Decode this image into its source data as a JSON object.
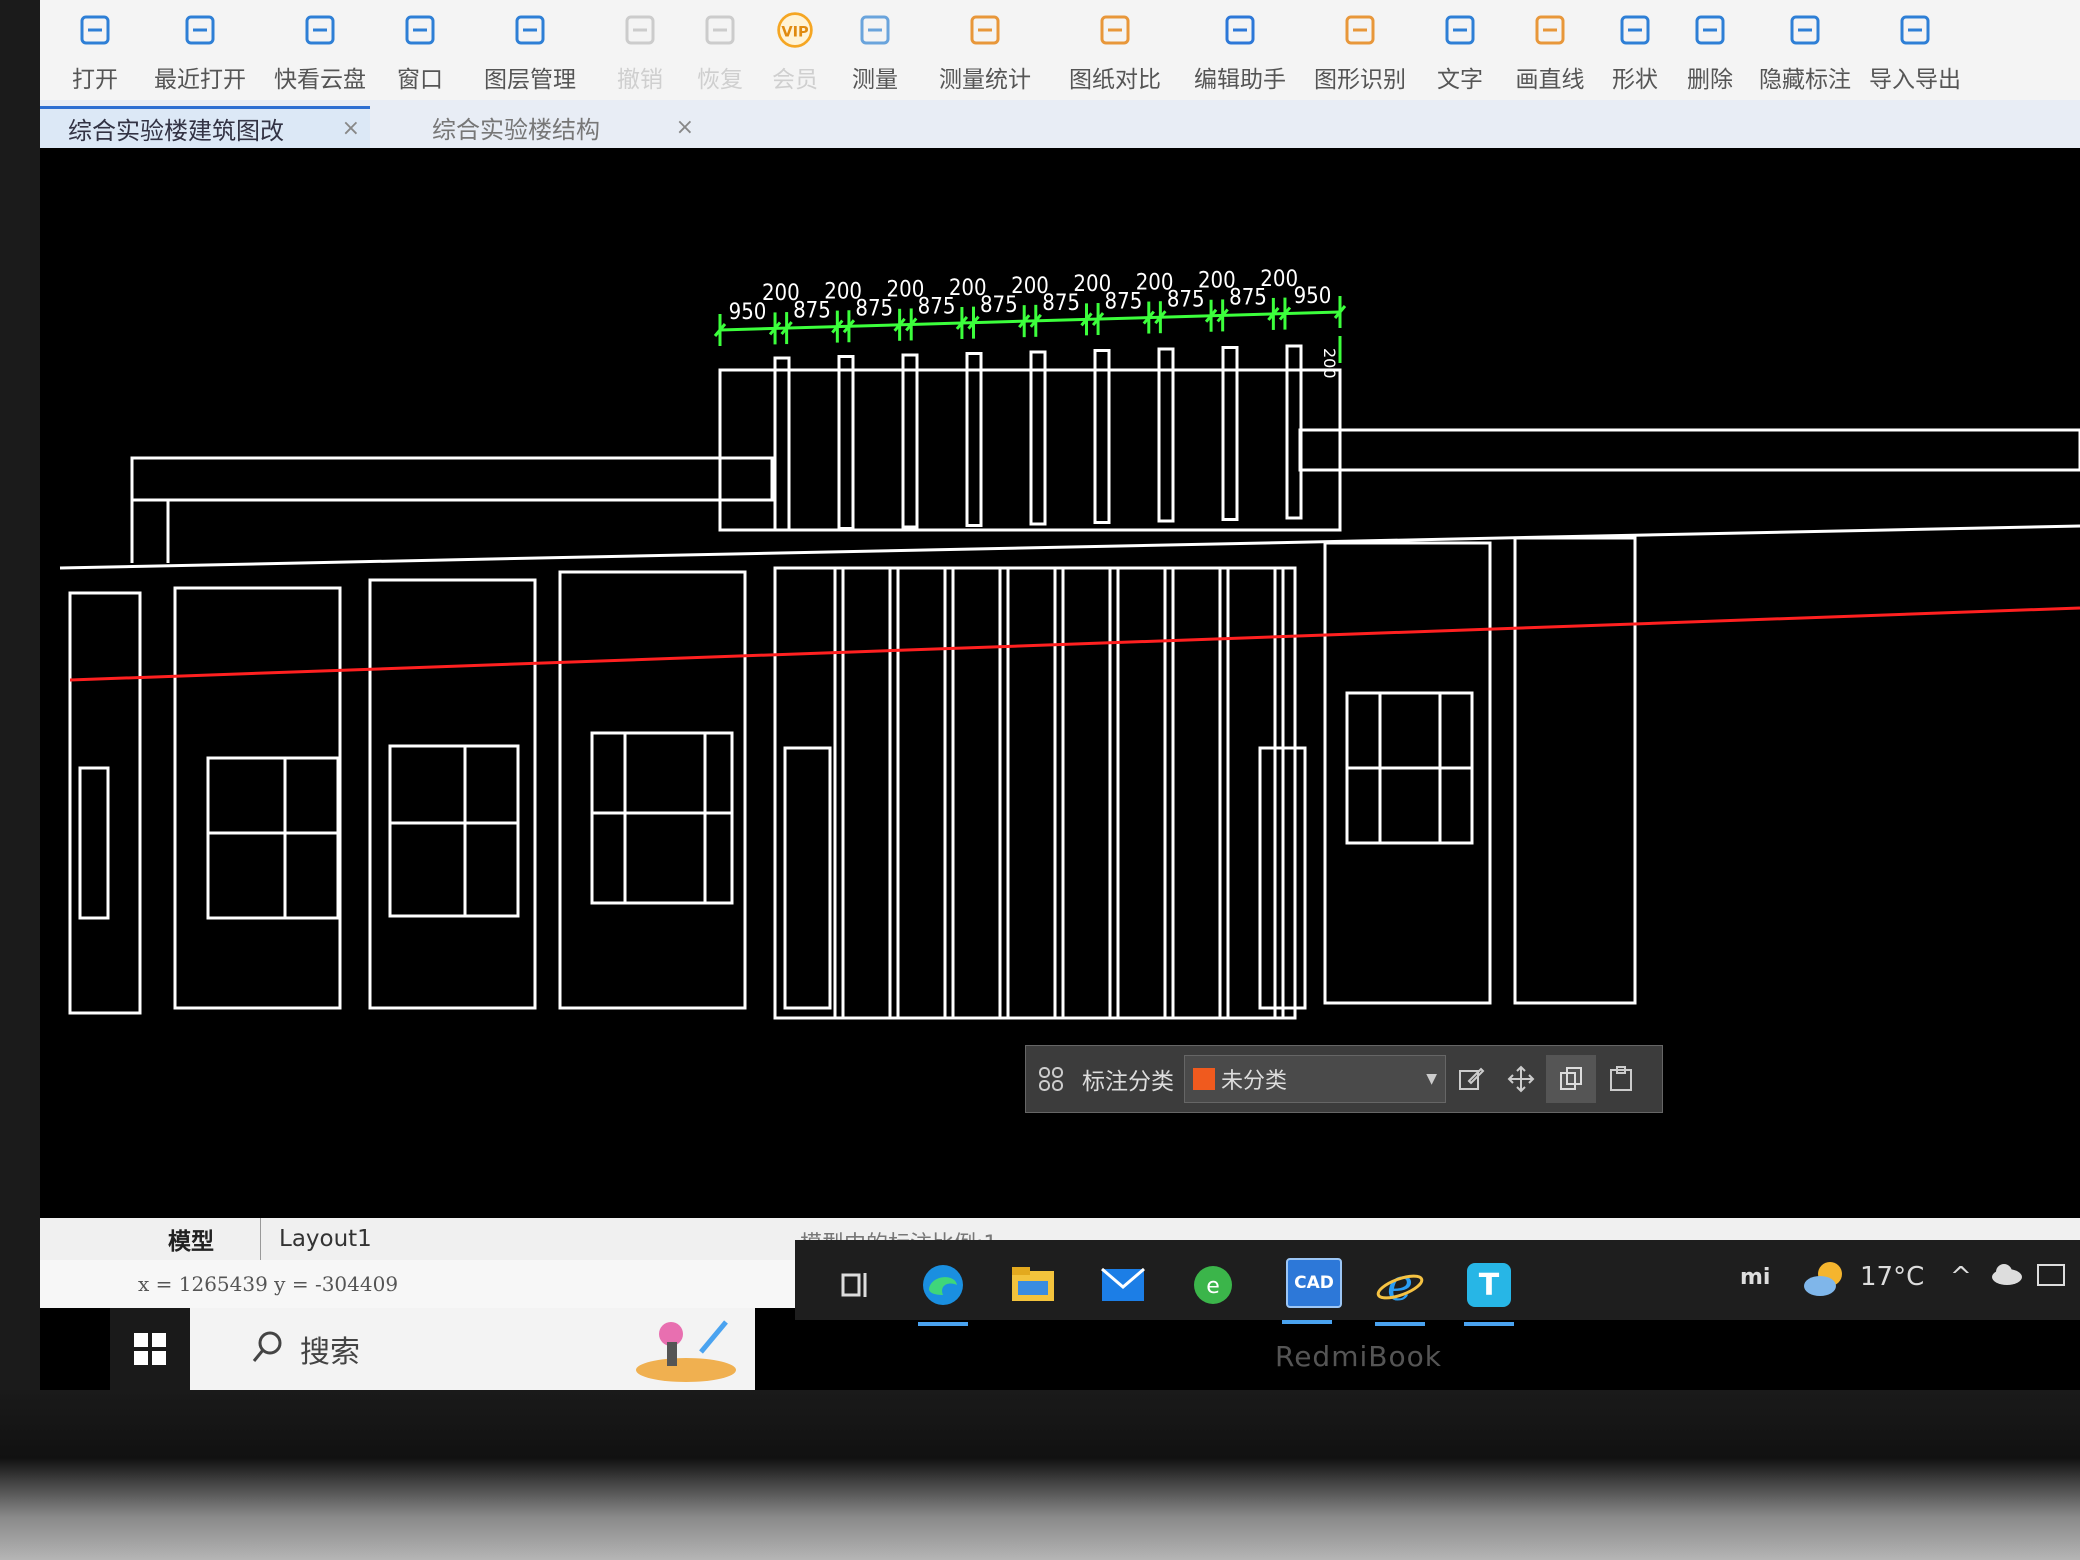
{
  "toolbar": {
    "items": [
      {
        "label": "打开",
        "icon": "folder-open-icon",
        "disabled": false
      },
      {
        "label": "最近打开",
        "icon": "history-clock-icon",
        "disabled": false
      },
      {
        "label": "快看云盘",
        "icon": "cloud-icon",
        "disabled": false
      },
      {
        "label": "窗口",
        "icon": "window-icon",
        "disabled": false
      },
      {
        "label": "图层管理",
        "icon": "layers-icon",
        "disabled": false
      },
      {
        "label": "撤销",
        "icon": "undo-icon",
        "disabled": true
      },
      {
        "label": "恢复",
        "icon": "redo-icon",
        "disabled": true
      },
      {
        "label": "会员",
        "icon": "vip-icon",
        "disabled": true
      },
      {
        "label": "测量",
        "icon": "ruler-icon",
        "disabled": false
      },
      {
        "label": "测量统计",
        "icon": "measure-stats-icon",
        "disabled": false
      },
      {
        "label": "图纸对比",
        "icon": "compare-icon",
        "disabled": false
      },
      {
        "label": "编辑助手",
        "icon": "edit-assistant-icon",
        "disabled": false
      },
      {
        "label": "图形识别",
        "icon": "shape-recognize-icon",
        "disabled": false
      },
      {
        "label": "文字",
        "icon": "text-icon",
        "disabled": false
      },
      {
        "label": "画直线",
        "icon": "line-icon",
        "disabled": false
      },
      {
        "label": "形状",
        "icon": "shapes-icon",
        "disabled": false
      },
      {
        "label": "删除",
        "icon": "eraser-icon",
        "disabled": false
      },
      {
        "label": "隐藏标注",
        "icon": "hide-eye-icon",
        "disabled": false
      },
      {
        "label": "导入导出",
        "icon": "export-icon",
        "disabled": false
      }
    ],
    "vip_badge": "VIP"
  },
  "tabs": [
    {
      "label": "综合实验楼建筑图改",
      "active": true
    },
    {
      "label": "综合实验楼结构",
      "active": false
    }
  ],
  "tab_close_glyph": "×",
  "dimensions": {
    "labels": [
      "950",
      "200",
      "875",
      "200",
      "875",
      "200",
      "875",
      "200",
      "875",
      "200",
      "875",
      "200",
      "875",
      "200",
      "875",
      "200",
      "875",
      "200",
      "950"
    ],
    "side_label": "200"
  },
  "annotation_bar": {
    "label": "标注分类",
    "selected": "未分类",
    "swatch_color": "#f05a1e"
  },
  "layout_tabs": [
    "模型",
    "Layout1"
  ],
  "scale_note": "模型中的标注比例:1",
  "coords": "x = 1265439  y = -304409",
  "taskbar": {
    "search_placeholder": "搜索",
    "cad_label": "CAD",
    "weather": "17°C",
    "tray_brand": "mi"
  },
  "laptop_brand": "RedmiBook",
  "colors": {
    "dimension": "#3cff3c",
    "drawing_lines": "#ffffff",
    "axis_line": "#ff2020",
    "active_tab_accent": "#2d6fd2"
  }
}
